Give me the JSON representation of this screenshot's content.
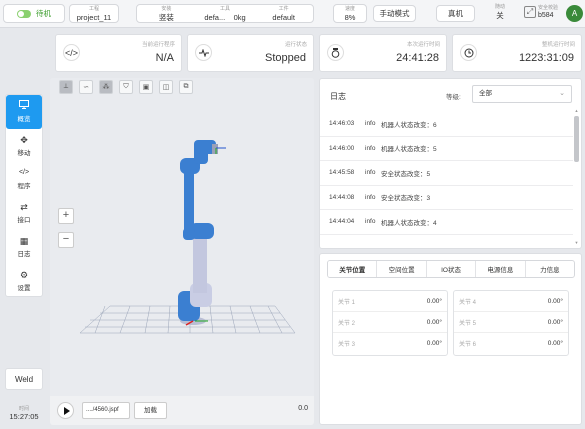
{
  "topbar": {
    "status": "待机",
    "project": {
      "label": "工程",
      "value": "project_11"
    },
    "install": {
      "label": "安装",
      "value": "竖装"
    },
    "tool": {
      "label": "工具",
      "value": "defa...",
      "extra": "0kg"
    },
    "workpiece": {
      "label": "工件",
      "value": "default"
    },
    "speed": {
      "label": "速度",
      "value": "8%"
    },
    "manual_mode": "手动模式",
    "real_machine": "真机",
    "dock": {
      "label": "随动",
      "value": "关"
    },
    "safety": {
      "label": "安全校验",
      "value": "b584"
    },
    "avatar": "A"
  },
  "cards": {
    "program": {
      "label": "当前运行程序",
      "value": "N/A"
    },
    "run_status": {
      "label": "运行状态",
      "value": "Stopped"
    },
    "this_run": {
      "label": "本次运行时间",
      "value": "24:41:28"
    },
    "total_run": {
      "label": "整机运行时间",
      "value": "1223:31:09"
    }
  },
  "sidebar": {
    "items": [
      {
        "label": "概览",
        "icon": "monitor-icon",
        "glyph": "🖵"
      },
      {
        "label": "移动",
        "icon": "move-icon",
        "glyph": "✥"
      },
      {
        "label": "程序",
        "icon": "code-icon",
        "glyph": "</>"
      },
      {
        "label": "接口",
        "icon": "interface-icon",
        "glyph": "⇄"
      },
      {
        "label": "日志",
        "icon": "calendar-icon",
        "glyph": "▦"
      },
      {
        "label": "设置",
        "icon": "gear-icon",
        "glyph": "⚙"
      }
    ],
    "weld": "Weld",
    "time_label": "时间",
    "time_value": "15:27:05"
  },
  "viewer": {
    "file": "..../4560.jspf",
    "load": "加载",
    "value": "0.0"
  },
  "log": {
    "title": "日志",
    "level_label": "等级:",
    "level_value": "全部",
    "rows": [
      {
        "time": "14:46:03",
        "level": "info",
        "msg": "机器人状态改变：6"
      },
      {
        "time": "14:46:00",
        "level": "info",
        "msg": "机器人状态改变：5"
      },
      {
        "time": "14:45:58",
        "level": "info",
        "msg": "安全状态改变：5"
      },
      {
        "time": "14:44:08",
        "level": "info",
        "msg": "安全状态改变：3"
      },
      {
        "time": "14:44:04",
        "level": "info",
        "msg": "机器人状态改变：4"
      }
    ]
  },
  "joints": {
    "tabs": [
      "关节位置",
      "空间位置",
      "IO状态",
      "电源信息",
      "力信息"
    ],
    "left": [
      {
        "name": "关节 1",
        "value": "0.00°"
      },
      {
        "name": "关节 2",
        "value": "0.00°"
      },
      {
        "name": "关节 3",
        "value": "0.00°"
      }
    ],
    "right": [
      {
        "name": "关节 4",
        "value": "0.00°"
      },
      {
        "name": "关节 5",
        "value": "0.00°"
      },
      {
        "name": "关节 6",
        "value": "0.00°"
      }
    ]
  },
  "colors": {
    "accent": "#1e9af0",
    "status_green": "#3a9c2a",
    "robot_blue": "#3b7fd1"
  }
}
